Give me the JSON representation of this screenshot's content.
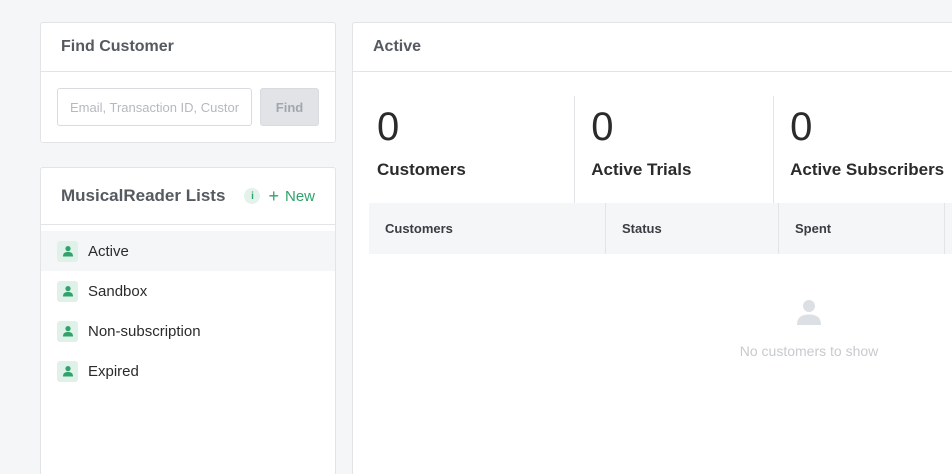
{
  "find_customer": {
    "title": "Find Customer",
    "placeholder": "Email, Transaction ID, Customer ID",
    "button_label": "Find"
  },
  "lists": {
    "title": "MusicalReader Lists",
    "info_label": "i",
    "new_label": "New",
    "items": [
      {
        "label": "Active"
      },
      {
        "label": "Sandbox"
      },
      {
        "label": "Non-subscription"
      },
      {
        "label": "Expired"
      }
    ]
  },
  "active_panel": {
    "title": "Active",
    "stats": [
      {
        "value": "0",
        "label": "Customers"
      },
      {
        "value": "0",
        "label": "Active Trials"
      },
      {
        "value": "0",
        "label": "Active Subscribers"
      }
    ],
    "columns": [
      "Customers",
      "Status",
      "Spent"
    ],
    "empty_text": "No customers to show"
  },
  "colors": {
    "accent": "#2fa36b",
    "badge_bg": "#dff1e8",
    "page_bg": "#f5f6f8"
  },
  "icons": {
    "list_item": "user-icon",
    "empty_state": "user-icon",
    "info": "info-icon",
    "new": "plus-icon"
  }
}
